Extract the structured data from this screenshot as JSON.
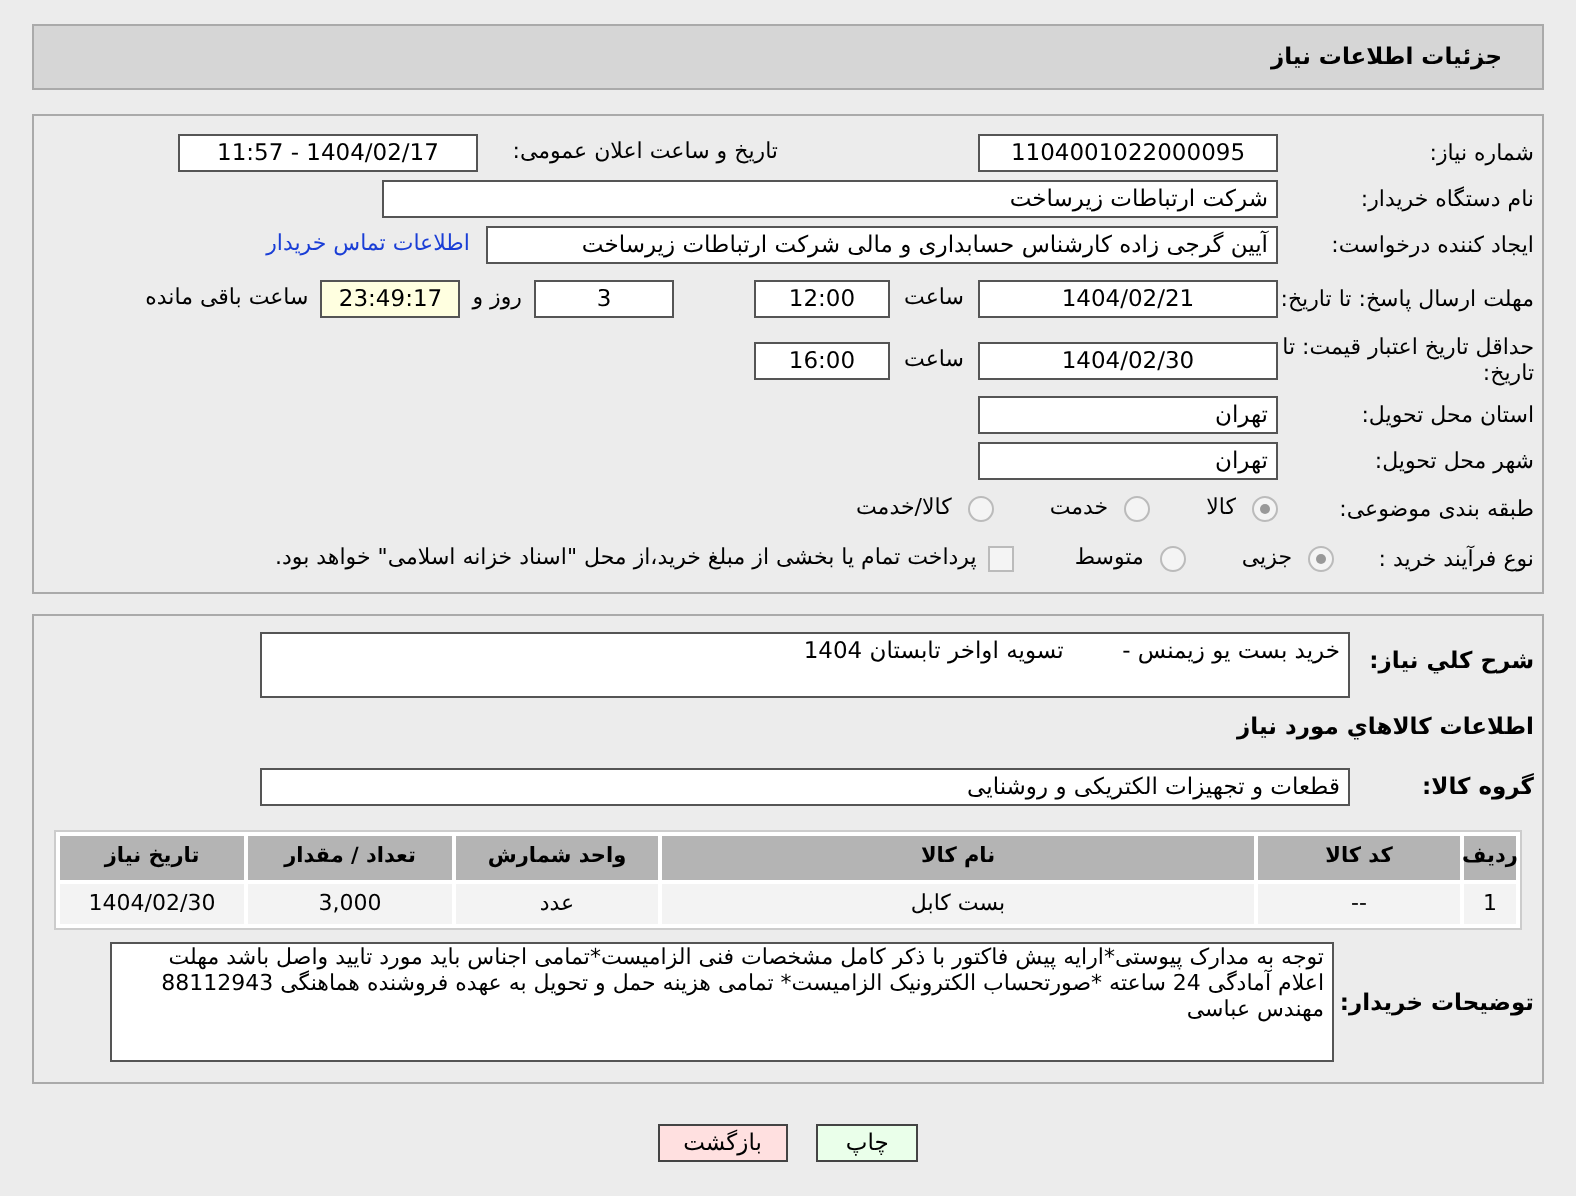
{
  "header": {
    "title": "جزئیات اطلاعات نیاز"
  },
  "need_number": {
    "label": "شماره نیاز:",
    "value": "1104001022000095"
  },
  "announce": {
    "label": "تاریخ و ساعت اعلان عمومی:",
    "value": "1404/02/17 - 11:57"
  },
  "buyer": {
    "label": "نام دستگاه خریدار:",
    "value": "شرکت ارتباطات زیرساخت"
  },
  "requester": {
    "label": "ایجاد کننده درخواست:",
    "value": "آیین گرجی زاده کارشناس حسابداری و مالی شرکت ارتباطات زیرساخت",
    "link": "اطلاعات تماس خریدار"
  },
  "deadline": {
    "label": "مهلت ارسال پاسخ: تا تاریخ:",
    "date": "1404/02/21",
    "time_label": "ساعت",
    "time": "12:00",
    "days": "3",
    "days_label": "روز و",
    "remaining": "23:49:17",
    "remaining_label": "ساعت باقی مانده"
  },
  "price_validity": {
    "label": "حداقل تاریخ اعتبار قیمت: تا تاریخ:",
    "date": "1404/02/30",
    "time_label": "ساعت",
    "time": "16:00"
  },
  "province": {
    "label": "استان محل تحویل:",
    "value": "تهران"
  },
  "city": {
    "label": "شهر محل تحویل:",
    "value": "تهران"
  },
  "category": {
    "label": "طبقه بندی موضوعی:",
    "options": [
      {
        "label": "کالا",
        "selected": true
      },
      {
        "label": "خدمت",
        "selected": false
      },
      {
        "label": "کالا/خدمت",
        "selected": false
      }
    ]
  },
  "process": {
    "label": "نوع فرآیند خرید :",
    "options": [
      {
        "label": "جزیی",
        "selected": true
      },
      {
        "label": "متوسط",
        "selected": false
      }
    ],
    "payment": {
      "label": "پرداخت تمام یا بخشی از مبلغ خرید،از محل \"اسناد خزانه اسلامی\" خواهد بود.",
      "checked": false
    }
  },
  "description": {
    "label": "شرح کلي نياز:",
    "value": "خرید بست یو زیمنس -        تسویه اواخر تابستان 1404"
  },
  "goods_title": "اطلاعات کالاهاي مورد نياز",
  "goods_group": {
    "label": "گروه کالا:",
    "value": "قطعات و تجهیزات الکتریکی و روشنایی"
  },
  "table": {
    "columns": [
      "ردیف",
      "کد کالا",
      "نام کالا",
      "واحد شمارش",
      "تعداد / مقدار",
      "تاریخ نیاز"
    ],
    "rows": [
      [
        "1",
        "--",
        "بست کابل",
        "عدد",
        "3,000",
        "1404/02/30"
      ]
    ]
  },
  "notes": {
    "label": "توضیحات خریدار:",
    "value": "توجه به مدارک پیوستی*ارایه پیش فاکتور با ذکر کامل مشخصات فنی الزامیست*تمامی اجناس باید مورد تایید واصل باشد مهلت اعلام آمادگی 24 ساعته *صورتحساب الکترونیک الزامیست* تمامی هزینه حمل و تحویل به عهده فروشنده هماهنگی 88112943 مهندس عباسی"
  },
  "buttons": [
    {
      "kind": "print",
      "label": "چاپ"
    },
    {
      "kind": "back",
      "label": "بازگشت"
    }
  ]
}
